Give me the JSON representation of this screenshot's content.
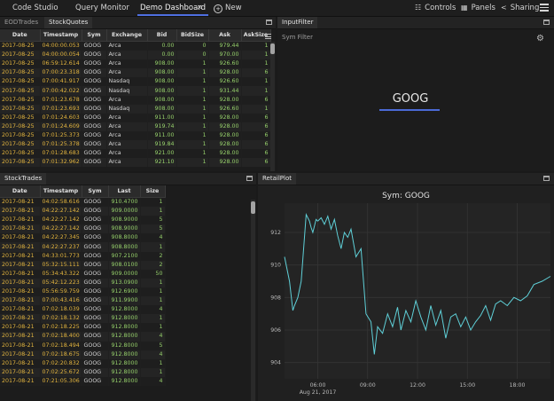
{
  "nav": {
    "tabs": [
      "Code Studio",
      "Query Monitor",
      "Demo Dashboard"
    ],
    "close": "✕",
    "new_label": "New",
    "controls_label": "Controls",
    "panels_label": "Panels",
    "sharing_label": "Sharing"
  },
  "stockquotes": {
    "tabs": [
      "EODTrades",
      "StockQuotes"
    ],
    "columns": [
      "Date",
      "Timestamp",
      "Sym",
      "Exchange",
      "Bid",
      "BidSize",
      "Ask",
      "AskSize"
    ],
    "rows": [
      [
        "2017-08-25",
        "04:00:00.053",
        "GOOG",
        "Arca",
        "0.00",
        "0",
        "979.44",
        "1"
      ],
      [
        "2017-08-25",
        "04:00:00.054",
        "GOOG",
        "Arca",
        "0.00",
        "0",
        "970.00",
        "1"
      ],
      [
        "2017-08-25",
        "06:59:12.614",
        "GOOG",
        "Arca",
        "908.00",
        "1",
        "926.60",
        "1"
      ],
      [
        "2017-08-25",
        "07:00:23.318",
        "GOOG",
        "Arca",
        "908.00",
        "1",
        "928.00",
        "6"
      ],
      [
        "2017-08-25",
        "07:00:41.917",
        "GOOG",
        "Nasdaq",
        "908.00",
        "1",
        "926.60",
        "1"
      ],
      [
        "2017-08-25",
        "07:00:42.022",
        "GOOG",
        "Nasdaq",
        "908.00",
        "1",
        "931.44",
        "1"
      ],
      [
        "2017-08-25",
        "07:01:23.678",
        "GOOG",
        "Arca",
        "908.00",
        "1",
        "928.00",
        "6"
      ],
      [
        "2017-08-25",
        "07:01:23.693",
        "GOOG",
        "Nasdaq",
        "908.00",
        "1",
        "926.60",
        "1"
      ],
      [
        "2017-08-25",
        "07:01:24.603",
        "GOOG",
        "Arca",
        "911.00",
        "1",
        "928.00",
        "6"
      ],
      [
        "2017-08-25",
        "07:01:24.609",
        "GOOG",
        "Arca",
        "919.74",
        "1",
        "928.00",
        "6"
      ],
      [
        "2017-08-25",
        "07:01:25.373",
        "GOOG",
        "Arca",
        "911.00",
        "1",
        "928.00",
        "6"
      ],
      [
        "2017-08-25",
        "07:01:25.378",
        "GOOG",
        "Arca",
        "919.84",
        "1",
        "928.00",
        "6"
      ],
      [
        "2017-08-25",
        "07:01:28.683",
        "GOOG",
        "Arca",
        "921.00",
        "1",
        "928.00",
        "6"
      ],
      [
        "2017-08-25",
        "07:01:32.962",
        "GOOG",
        "Arca",
        "921.10",
        "1",
        "928.00",
        "6"
      ]
    ]
  },
  "inputfilter": {
    "tab": "InputFilter",
    "label": "Sym Filter",
    "value": "GOOG"
  },
  "stocktrades": {
    "tab": "StockTrades",
    "columns": [
      "Date",
      "Timestamp",
      "Sym",
      "Last",
      "Size"
    ],
    "rows": [
      [
        "2017-08-21",
        "04:02:58.616",
        "GOOG",
        "910.4700",
        "1"
      ],
      [
        "2017-08-21",
        "04:22:27.142",
        "GOOG",
        "909.0000",
        "1"
      ],
      [
        "2017-08-21",
        "04:22:27.142",
        "GOOG",
        "908.9000",
        "5"
      ],
      [
        "2017-08-21",
        "04:22:27.142",
        "GOOG",
        "908.9000",
        "5"
      ],
      [
        "2017-08-21",
        "04:22:27.345",
        "GOOG",
        "908.8000",
        "4"
      ],
      [
        "2017-08-21",
        "04:22:27.237",
        "GOOG",
        "908.8000",
        "1"
      ],
      [
        "2017-08-21",
        "04:33:01.773",
        "GOOG",
        "907.2100",
        "2"
      ],
      [
        "2017-08-21",
        "05:32:15.111",
        "GOOG",
        "908.0100",
        "2"
      ],
      [
        "2017-08-21",
        "05:34:43.322",
        "GOOG",
        "909.0000",
        "50"
      ],
      [
        "2017-08-21",
        "05:42:12.223",
        "GOOG",
        "913.0900",
        "1"
      ],
      [
        "2017-08-21",
        "05:56:59.759",
        "GOOG",
        "912.6900",
        "1"
      ],
      [
        "2017-08-21",
        "07:00:43.416",
        "GOOG",
        "911.9900",
        "1"
      ],
      [
        "2017-08-21",
        "07:02:18.039",
        "GOOG",
        "912.8000",
        "4"
      ],
      [
        "2017-08-21",
        "07:02:18.132",
        "GOOG",
        "912.8000",
        "1"
      ],
      [
        "2017-08-21",
        "07:02:18.225",
        "GOOG",
        "912.8000",
        "1"
      ],
      [
        "2017-08-21",
        "07:02:18.400",
        "GOOG",
        "912.8000",
        "4"
      ],
      [
        "2017-08-21",
        "07:02:18.494",
        "GOOG",
        "912.8000",
        "5"
      ],
      [
        "2017-08-21",
        "07:02:18.675",
        "GOOG",
        "912.8000",
        "4"
      ],
      [
        "2017-08-21",
        "07:02:20.832",
        "GOOG",
        "912.8000",
        "1"
      ],
      [
        "2017-08-21",
        "07:02:25.672",
        "GOOG",
        "912.8000",
        "1"
      ],
      [
        "2017-08-21",
        "07:21:05.306",
        "GOOG",
        "912.8000",
        "4"
      ]
    ]
  },
  "retailplot": {
    "tab": "RetailPlot",
    "colors": {
      "line": "#5fd0d8"
    }
  },
  "chart_data": {
    "type": "line",
    "title": "Sym: GOOG",
    "x_ticks": [
      "06:00",
      "09:00",
      "12:00",
      "15:00",
      "18:00"
    ],
    "x_subtitle": "Aug 21, 2017",
    "y_ticks": [
      "904",
      "906",
      "908",
      "910",
      "912"
    ],
    "ylim": [
      903.0,
      913.8
    ],
    "xlim": [
      4.0,
      20.0
    ],
    "grid": true,
    "series": [
      {
        "x": [
          4.0,
          4.3,
          4.5,
          4.6,
          4.8,
          5.0,
          5.3,
          5.5,
          5.6,
          5.7,
          5.9,
          6.0,
          6.2,
          6.4,
          6.6,
          6.8,
          7.0,
          7.2,
          7.4,
          7.6,
          7.8,
          8.0,
          8.3,
          8.6,
          8.9,
          9.2,
          9.4,
          9.6,
          9.9,
          10.2,
          10.5,
          10.8,
          11.0,
          11.3,
          11.6,
          11.9,
          12.2,
          12.5,
          12.8,
          13.1,
          13.4,
          13.7,
          14.0,
          14.3,
          14.6,
          14.9,
          15.2,
          15.5,
          15.8,
          16.1,
          16.4,
          16.7,
          17.0,
          17.4,
          17.8,
          18.2,
          18.6,
          19.0,
          19.5,
          20.0
        ],
        "y": [
          910.5,
          909.0,
          907.2,
          907.5,
          908.0,
          909.0,
          913.1,
          912.7,
          912.3,
          912.0,
          912.8,
          912.7,
          912.9,
          912.5,
          913.0,
          912.2,
          912.8,
          911.8,
          911.0,
          912.0,
          911.7,
          912.2,
          910.5,
          911.0,
          907.0,
          906.5,
          904.5,
          906.2,
          905.8,
          907.0,
          906.2,
          907.4,
          906.0,
          907.2,
          906.5,
          907.8,
          906.8,
          906.0,
          907.5,
          906.3,
          907.2,
          905.5,
          906.8,
          907.0,
          906.2,
          906.8,
          906.0,
          906.5,
          906.9,
          907.5,
          906.6,
          907.6,
          907.8,
          907.5,
          908.0,
          907.8,
          908.1,
          908.8,
          909.0,
          909.3
        ]
      }
    ]
  }
}
